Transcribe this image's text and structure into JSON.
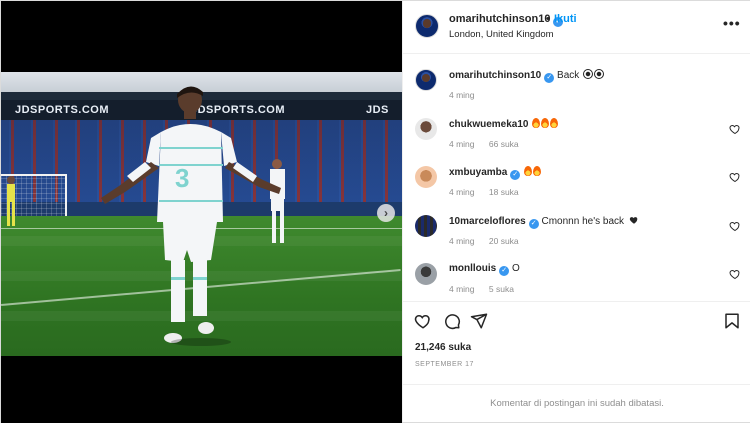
{
  "post": {
    "username": "omarihutchinson10",
    "follow_label": "Ikuti",
    "separator": "•",
    "location": "London, United Kingdom",
    "more_label": "•••",
    "caption_text": "Back",
    "caption_time": "4 ming",
    "likes": "21,246 suka",
    "date": "SEPTEMBER 17",
    "comments_disabled": "Komentar di postingan ini sudah dibatasi."
  },
  "media": {
    "ad_text_1": "JDSPORTS.COM",
    "ad_text_2": "JDSPORTS.COM",
    "ad_text_3": "JDS",
    "next_arrow": "›"
  },
  "comments": [
    {
      "username": "chukwuemeka10",
      "text": "",
      "emoji": [
        "fire",
        "fire",
        "fire"
      ],
      "time": "4 ming",
      "likes": "66 suka",
      "verified": true
    },
    {
      "username": "xmbuyamba",
      "text": "",
      "emoji": [
        "fire",
        "fire"
      ],
      "time": "4 ming",
      "likes": "18 suka",
      "verified": true
    },
    {
      "username": "10marceloflores",
      "text": "Cmonnn he's back",
      "emoji": [
        "black-heart"
      ],
      "time": "4 ming",
      "likes": "20 suka",
      "verified": true
    },
    {
      "username": "monllouis",
      "text": "O",
      "emoji": [],
      "time": "4 ming",
      "likes": "5 suka",
      "verified": true
    }
  ],
  "colors": {
    "accent": "#0095f6",
    "verified": "#3897f0",
    "muted": "#8e8e8e",
    "text": "#262626"
  },
  "icons": [
    "verified-icon",
    "more-icon",
    "heart-icon",
    "comment-icon",
    "share-icon",
    "bookmark-icon",
    "next-arrow-icon"
  ]
}
